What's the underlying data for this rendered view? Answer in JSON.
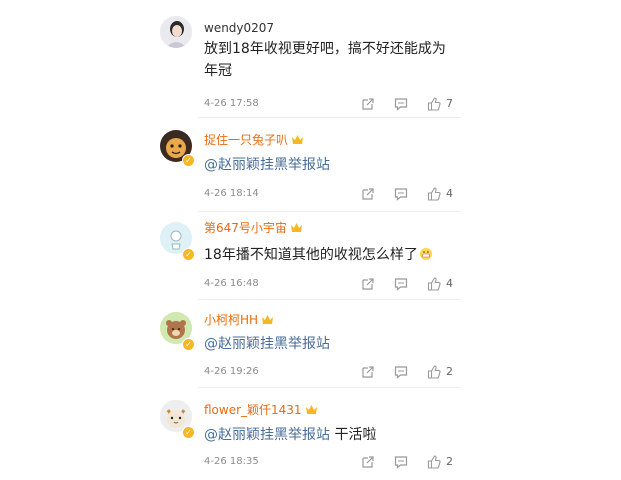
{
  "comments": [
    {
      "user": "wendy0207",
      "vip": false,
      "text": "放到18年收视更好吧，搞不好还能成为年冠",
      "mention": "",
      "suffix": "",
      "time": "4-26 17:58",
      "likes": "7",
      "avatar": "portrait-avatar"
    },
    {
      "user": "捉住一只兔子叭",
      "vip": true,
      "text": "",
      "mention": "@赵丽颖挂黑举报站",
      "suffix": "",
      "time": "4-26 18:14",
      "likes": "4",
      "avatar": "cartoon-avatar"
    },
    {
      "user": "第647号小宇宙",
      "vip": true,
      "text": "18年播不知道其他的收视怎么样了",
      "mention": "",
      "suffix": "",
      "time": "4-26 16:48",
      "likes": "4",
      "avatar": "light-blue-avatar"
    },
    {
      "user": "小柯柯HH",
      "vip": true,
      "text": "",
      "mention": "@赵丽颖挂黑举报站",
      "suffix": "",
      "time": "4-26 19:26",
      "likes": "2",
      "avatar": "bear-avatar"
    },
    {
      "user": "flower_颖仟1431",
      "vip": true,
      "text": "",
      "mention": "@赵丽颖挂黑举报站",
      "suffix": " 干活啦",
      "time": "4-26 18:35",
      "likes": "2",
      "avatar": "cat-avatar"
    }
  ],
  "icons": {
    "share": "share-icon",
    "reply": "comment-icon",
    "like": "thumbs-up-icon",
    "vip": "crown-icon",
    "emoji": "grin-emoji-icon"
  },
  "colors": {
    "username_vip": "#e86b0f",
    "mention": "#4a6d99",
    "badge": "#f5b823"
  }
}
